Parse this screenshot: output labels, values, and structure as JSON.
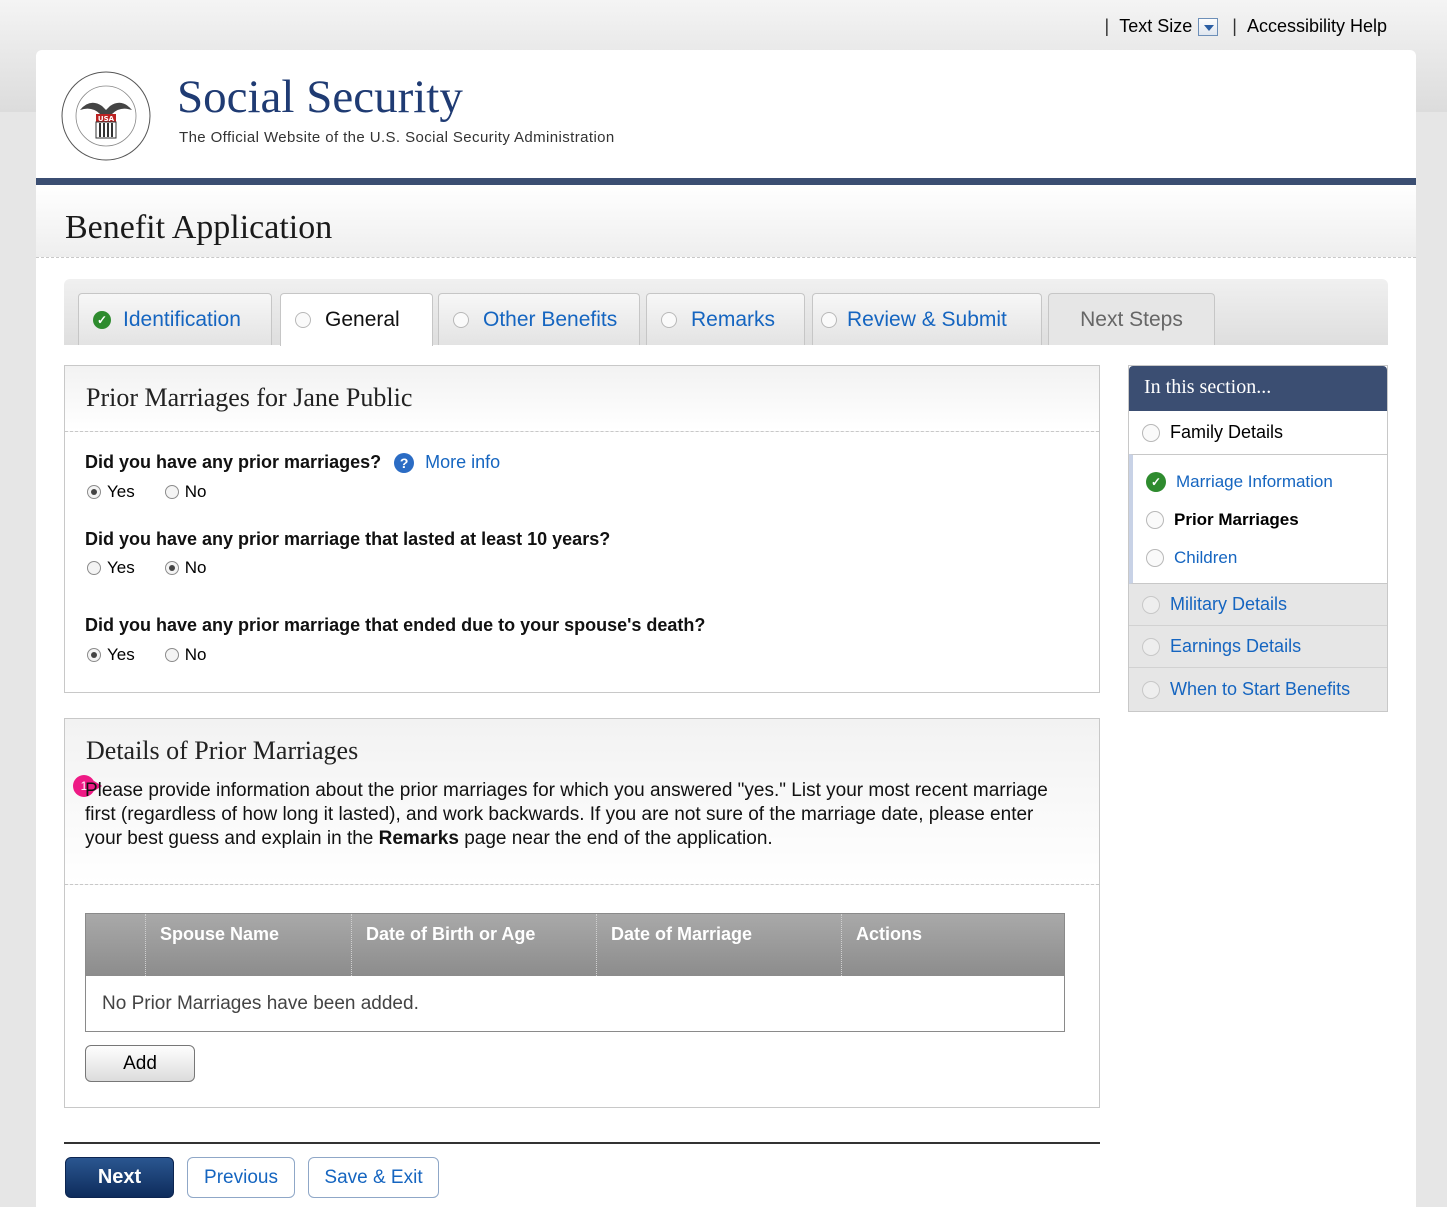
{
  "utility": {
    "sep": "|",
    "text_size": "Text Size",
    "accessibility_help": "Accessibility Help"
  },
  "header": {
    "title": "Social Security",
    "subtitle": "The Official Website of the U.S. Social Security Administration"
  },
  "page_title": "Benefit Application",
  "tabs": [
    {
      "label": "Identification",
      "status": "complete"
    },
    {
      "label": "General",
      "status": "active"
    },
    {
      "label": "Other Benefits",
      "status": "pending"
    },
    {
      "label": "Remarks",
      "status": "pending"
    },
    {
      "label": "Review & Submit",
      "status": "pending"
    },
    {
      "label": "Next Steps",
      "status": "disabled"
    }
  ],
  "prior_marriages": {
    "title": "Prior Marriages for Jane Public",
    "more_info": "More info",
    "questions": [
      {
        "text": "Did you have any prior marriages?",
        "answer": "Yes"
      },
      {
        "text": "Did you have any prior marriage that lasted at least 10 years?",
        "answer": "No"
      },
      {
        "text": "Did you have any prior marriage that ended due to your spouse's death?",
        "answer": "Yes"
      }
    ],
    "option_yes": "Yes",
    "option_no": "No"
  },
  "details": {
    "title": "Details of Prior Marriages",
    "marker": "1",
    "desc_before": "Please provide information about the prior marriages for which you answered \"yes.\" List your most recent marriage first (regardless of how long it lasted), and work backwards. If you are not sure of the marriage date, please enter your best guess and explain in the ",
    "desc_bold": "Remarks",
    "desc_after": " page near the end of the application.",
    "table": {
      "columns": [
        "",
        "Spouse Name",
        "Date of Birth or Age",
        "Date of Marriage",
        "Actions"
      ],
      "empty_text": "No Prior Marriages have been added."
    },
    "add_label": "Add"
  },
  "sidebar": {
    "title": "In this section...",
    "top": {
      "label": "Family Details"
    },
    "sub_items": [
      {
        "label": "Marriage Information",
        "status": "complete"
      },
      {
        "label": "Prior Marriages",
        "status": "current"
      },
      {
        "label": "Children",
        "status": "pending"
      }
    ],
    "bottom": [
      {
        "label": "Military Details"
      },
      {
        "label": "Earnings Details"
      },
      {
        "label": "When to Start Benefits"
      }
    ]
  },
  "nav": {
    "next": "Next",
    "previous": "Previous",
    "save_exit": "Save & Exit"
  },
  "colors": {
    "brand_navy": "#3b4e72",
    "link_blue": "#1565c0",
    "complete_green": "#2e8b2e",
    "marker_pink": "#ee1a85"
  }
}
